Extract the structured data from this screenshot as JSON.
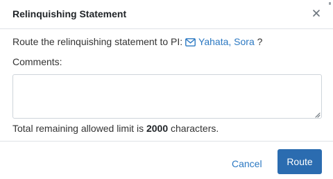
{
  "dialog": {
    "title": "Relinquishing Statement",
    "close_icon": "close-icon"
  },
  "route": {
    "prefix": "Route the relinquishing statement to PI:",
    "pi_name": "Yahata, Sora",
    "suffix": "?",
    "pi_icon": "envelope-icon"
  },
  "comments": {
    "label": "Comments:",
    "value": "",
    "placeholder": ""
  },
  "limit": {
    "prefix": "Total remaining allowed limit is",
    "count": "2000",
    "suffix": "characters."
  },
  "footer": {
    "cancel_label": "Cancel",
    "route_label": "Route"
  },
  "colors": {
    "link": "#2b78c2",
    "primary_button": "#2b6cb0",
    "divider": "#dee2e6"
  }
}
